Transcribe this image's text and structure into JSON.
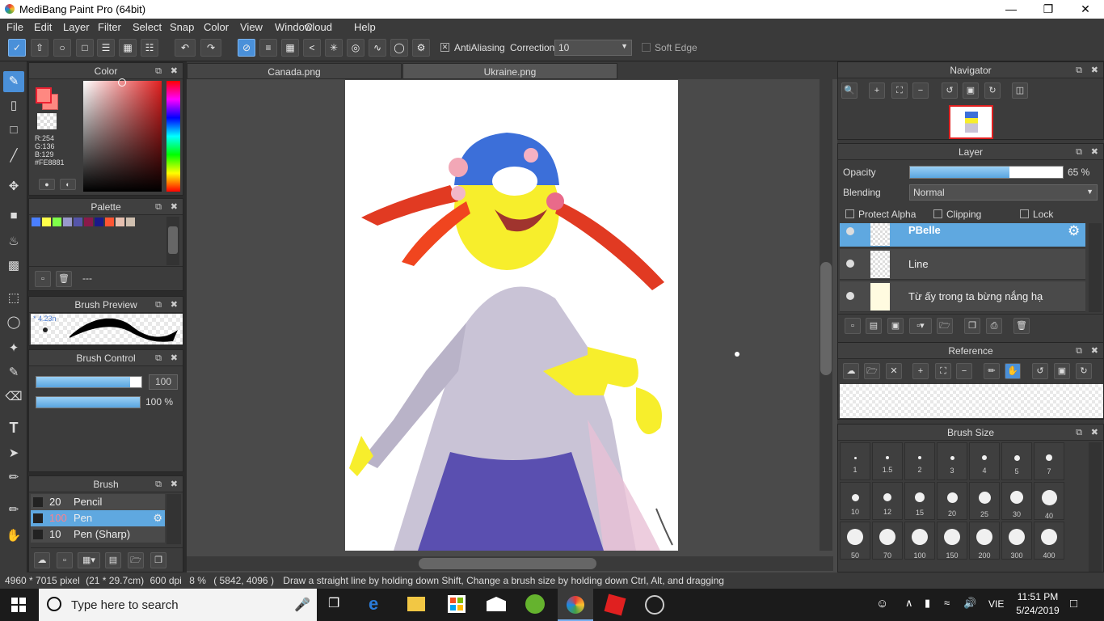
{
  "window": {
    "title": "MediBang Paint Pro (64bit)"
  },
  "menu": [
    "File",
    "Edit",
    "Layer",
    "Filter",
    "Select",
    "Snap",
    "Color",
    "View",
    "Window",
    "Cloud",
    "Help"
  ],
  "toolbar": {
    "antialiasing_label": "AntiAliasing",
    "correction_label": "Correction",
    "correction_value": "10",
    "soft_edge_label": "Soft Edge"
  },
  "color_panel": {
    "title": "Color",
    "r": "R:254",
    "g": "G:136",
    "b": "B:129",
    "hex": "#FE8881",
    "primary": "#fe8881"
  },
  "palette_panel": {
    "title": "Palette",
    "swatches": [
      "#4a7fff",
      "#ffff4a",
      "#7fff4a",
      "#9999cc",
      "#5555aa",
      "#8a1a4a",
      "#1a1a8a",
      "#ff5533",
      "#e6c0b0",
      "#d0c0b0"
    ],
    "name": "---"
  },
  "brush_preview": {
    "title": "Brush Preview",
    "size": "4.23n"
  },
  "brush_control": {
    "title": "Brush Control",
    "size": "100",
    "opacity": "100 %"
  },
  "brush_panel": {
    "title": "Brush",
    "items": [
      {
        "size": "20",
        "name": "Pencil"
      },
      {
        "size": "100",
        "name": "Pen"
      },
      {
        "size": "10",
        "name": "Pen (Sharp)"
      }
    ]
  },
  "tabs": [
    {
      "label": "Canada.png"
    },
    {
      "label": "Ukraine.png"
    }
  ],
  "navigator": {
    "title": "Navigator"
  },
  "layer_panel": {
    "title": "Layer",
    "opacity_label": "Opacity",
    "opacity_value": "65 %",
    "opacity_fraction": 0.65,
    "blending_label": "Blending",
    "blending_value": "Normal",
    "protect_alpha": "Protect Alpha",
    "clipping": "Clipping",
    "lock": "Lock",
    "layers": [
      {
        "name": "PBelle"
      },
      {
        "name": "Line"
      },
      {
        "name": "Từ ấy trong ta bừng nắng hạ"
      }
    ]
  },
  "reference": {
    "title": "Reference"
  },
  "brush_size": {
    "title": "Brush Size",
    "sizes": [
      "1",
      "1.5",
      "2",
      "3",
      "4",
      "5",
      "7",
      "10",
      "12",
      "15",
      "20",
      "25",
      "30",
      "40",
      "50",
      "70",
      "100",
      "150",
      "200",
      "300",
      "400"
    ]
  },
  "status": {
    "dimensions": "4960 * 7015 pixel",
    "paper": "(21 * 29.7cm)",
    "dpi": "600 dpi",
    "zoom": "8 %",
    "coords": "( 5842, 4096 )",
    "hint": "Draw a straight line by holding down Shift, Change a brush size by holding down Ctrl, Alt, and dragging"
  },
  "taskbar": {
    "search_placeholder": "Type here to search",
    "time": "11:51 PM",
    "date": "5/24/2019",
    "lang": "VIE"
  }
}
